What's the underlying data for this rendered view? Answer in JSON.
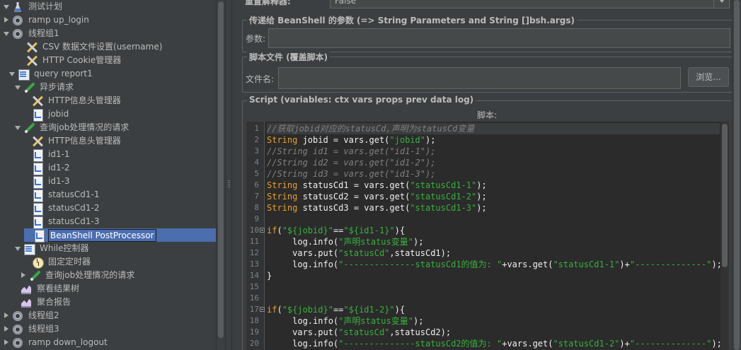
{
  "tree": {
    "nodes": [
      {
        "label": "测试计划",
        "icon": "flask-icon",
        "expander": "open"
      },
      {
        "label": "ramp up_login",
        "icon": "gear-icon",
        "expander": "closed"
      },
      {
        "label": "线程组1",
        "icon": "gear-icon",
        "expander": "open"
      },
      {
        "label": "CSV 数据文件设置(username)",
        "icon": "tools-icon",
        "expander": "none"
      },
      {
        "label": "HTTP Cookie管理器",
        "icon": "tools-icon",
        "expander": "none"
      },
      {
        "label": "query report1",
        "icon": "controller-icon",
        "expander": "open"
      },
      {
        "label": "异步请求",
        "icon": "pipette-icon",
        "expander": "open"
      },
      {
        "label": "HTTP信息头管理器",
        "icon": "tools-icon",
        "expander": "none"
      },
      {
        "label": "jobid",
        "icon": "document-icon",
        "expander": "none"
      },
      {
        "label": "查询job处理情况的请求",
        "icon": "pipette-icon",
        "expander": "open"
      },
      {
        "label": "HTTP信息头管理器",
        "icon": "tools-icon",
        "expander": "none"
      },
      {
        "label": "id1-1",
        "icon": "document-icon",
        "expander": "none"
      },
      {
        "label": "id1-2",
        "icon": "document-icon",
        "expander": "none"
      },
      {
        "label": "id1-3",
        "icon": "document-icon",
        "expander": "none"
      },
      {
        "label": "statusCd1-1",
        "icon": "document-icon",
        "expander": "none"
      },
      {
        "label": "statusCd1-2",
        "icon": "document-icon",
        "expander": "none"
      },
      {
        "label": "statusCd1-3",
        "icon": "document-icon",
        "expander": "none"
      },
      {
        "label": "BeanShell PostProcessor",
        "icon": "document-icon",
        "expander": "none",
        "selected": true
      },
      {
        "label": "While控制器",
        "icon": "controller-icon",
        "expander": "open"
      },
      {
        "label": "固定定时器",
        "icon": "timer-icon",
        "expander": "none"
      },
      {
        "label": "查询job处理情况的请求",
        "icon": "pipette-icon",
        "expander": "closed"
      },
      {
        "label": "察看结果树",
        "icon": "graph-icon",
        "expander": "none"
      },
      {
        "label": "聚合报告",
        "icon": "graph-icon",
        "expander": "none"
      },
      {
        "label": "线程组2",
        "icon": "gear-icon",
        "expander": "closed"
      },
      {
        "label": "线程组3",
        "icon": "gear-icon",
        "expander": "closed"
      },
      {
        "label": "ramp down_logout",
        "icon": "gear-icon",
        "expander": "closed"
      }
    ]
  },
  "panel": {
    "reset_label": "重置解释器:",
    "reset_value": "False",
    "params_legend": "传递给 BeanShell 的参数 (=> String Parameters and String []bsh.args)",
    "params_label": "参数:",
    "params_value": "",
    "file_legend": "脚本文件 (覆盖脚本)",
    "file_label": "文件名:",
    "file_value": "",
    "browse_label": "浏览...",
    "script_legend": "Script (variables: ctx vars props prev data log)",
    "script_label": "脚本:"
  },
  "code": {
    "lines": [
      {
        "n": "1",
        "t": "//获取jobid对应的statusCd,声明为statusCd变量",
        "hl": true
      },
      {
        "n": "2",
        "t": "String jobid = vars.get(\"jobid\");"
      },
      {
        "n": "3",
        "t": "//String id1 = vars.get(\"id1-1\");"
      },
      {
        "n": "4",
        "t": "//String id2 = vars.get(\"id1-2\");"
      },
      {
        "n": "5",
        "t": "//String id3 = vars.get(\"id1-3\");"
      },
      {
        "n": "6",
        "t": "String statusCd1 = vars.get(\"statusCd1-1\");"
      },
      {
        "n": "7",
        "t": "String statusCd2 = vars.get(\"statusCd1-2\");"
      },
      {
        "n": "8",
        "t": "String statusCd3 = vars.get(\"statusCd1-3\");"
      },
      {
        "n": "9",
        "t": ""
      },
      {
        "n": "10",
        "t": "if(\"${jobid}\"==\"${id1-1}\"){",
        "fold": true
      },
      {
        "n": "11",
        "t": "     log.info(\"声明status变量\");"
      },
      {
        "n": "12",
        "t": "     vars.put(\"statusCd\",statusCd1);"
      },
      {
        "n": "13",
        "t": "     log.info(\"--------------statusCd1的值为: \"+vars.get(\"statusCd1-1\")+\"--------------\");"
      },
      {
        "n": "14",
        "t": "}"
      },
      {
        "n": "15",
        "t": ""
      },
      {
        "n": "16",
        "t": ""
      },
      {
        "n": "17",
        "t": "if(\"${jobid}\"==\"${id1-2}\"){",
        "fold": true
      },
      {
        "n": "18",
        "t": "     log.info(\"声明status变量\");"
      },
      {
        "n": "19",
        "t": "     vars.put(\"statusCd\",statusCd2);"
      },
      {
        "n": "20",
        "t": "     log.info(\"--------------statusCd2的值为: \"+vars.get(\"statusCd1-2\")+\"--------------\");"
      }
    ]
  }
}
